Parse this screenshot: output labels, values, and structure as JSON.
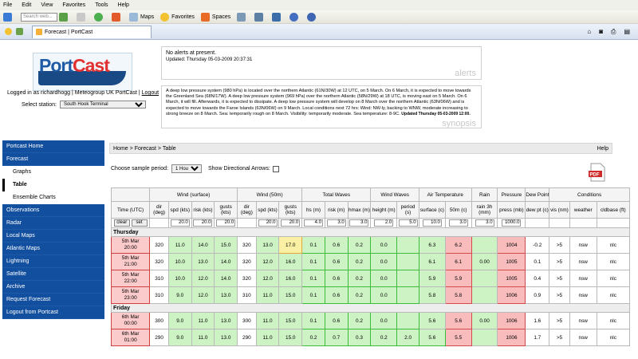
{
  "browser": {
    "menu": [
      "File",
      "Edit",
      "View",
      "Favorites",
      "Tools",
      "Help"
    ],
    "search_placeholder": "Search web...",
    "toolbar": {
      "maps": "Maps",
      "favorites": "Favorites",
      "spaces": "Spaces"
    },
    "tab_title": "Forecast | PortCast"
  },
  "header": {
    "logged_in": "Logged in as richardhogg",
    "org_link": "Meteogroup UK PortCast",
    "logout": "Logout",
    "station_label": "Select station:",
    "station_value": "South Hook Terminal"
  },
  "alerts": {
    "text": "No alerts at present.",
    "updated": "Updated: Thursday 05-03-2009 20:37:31",
    "label": "alerts"
  },
  "synopsis": {
    "text": "A deep low pressure system (980 hPa) is located over the northern Atlantic (61N/30W) at 12 UTC, on 5 March. On 6 March, it is expected to move towards the Greenland Sea (68N/17W). A deep low pressure system (969 hPa) over the northern Atlantic (58N/29W) at 18 UTC, is moving east on 5 March. On 6 March, it will fill. Afterwards, it is expected to dissipate. A deep low pressure system will develop on 8 March over the northern Atlantic (63N/06W) and is expected to move towards the Faroe Islands (63N/06W) on 9 March. Local conditions next 72 hrs: Wind: NW-ly, backing to WNW, moderate increasing to strong breeze on 8 March. Sea: temporarily rough on 8 March. Visibility: temporarily moderate. Sea temperature: 8-9C.",
    "updated": "Updated Thursday 05-03-2009 12:00.",
    "label": "synopsis"
  },
  "nav": {
    "items": [
      "Portcast Home",
      "Forecast"
    ],
    "sub": [
      "Graphs",
      "Table",
      "Ensemble Charts"
    ],
    "items2": [
      "Observations",
      "Radar",
      "Local Maps",
      "Atlantic Maps",
      "Lightning",
      "Satellite",
      "Archive",
      "Request Forecast",
      "Logout from Portcast"
    ]
  },
  "crumb": {
    "home": "Home",
    "sep": ">",
    "forecast": "Forecast",
    "table": "Table",
    "help": "Help"
  },
  "controls": {
    "period_label": "Choose sample period:",
    "period_value": "1 Hourly",
    "arrows_label": "Show Directional Arrows:"
  },
  "table": {
    "groups": [
      "Wind (surface)",
      "Wind (50m)",
      "Total Waves",
      "Wind Waves",
      "Air Temperature",
      "Rain",
      "Pressure",
      "Dew Point",
      "Conditions"
    ],
    "time_header": "Time (UTC)",
    "subheaders": [
      "dir (deg)",
      "spd (kts)",
      "risk (kts)",
      "gusts (kts)",
      "dir (deg)",
      "spd (kts)",
      "gusts (kts)",
      "hs (m)",
      "risk (m)",
      "hmax (m)",
      "height (m)",
      "period (s)",
      "surface (c)",
      "50m (c)",
      "rain 3h (mm)",
      "press (mb)",
      "dew pt (c)",
      "vis (nm)",
      "weather",
      "cldbase (ft)"
    ],
    "clear": "clear",
    "set": "set",
    "thresholds": [
      "",
      "20.0",
      "20.0",
      "20.0",
      "",
      "20.0",
      "20.0",
      "4.0",
      "3.0",
      "3.0",
      "2.0",
      "5.0",
      "10.0",
      "3.0",
      "3.0",
      "1000.0",
      "",
      "",
      "",
      ""
    ],
    "days": [
      {
        "label": "Thursday",
        "rows": [
          {
            "date": "5th Mar",
            "time": "20:00",
            "cells": [
              "320",
              "11.0",
              "14.0",
              "15.0",
              "320",
              "13.0",
              "17.0",
              "0.1",
              "0.6",
              "0.2",
              "0.0",
              "",
              "6.3",
              "6.2",
              "",
              "1004",
              "-0.2",
              ">5",
              "nsw",
              "nlc"
            ]
          },
          {
            "date": "5th Mar",
            "time": "21:00",
            "cells": [
              "320",
              "10.0",
              "13.0",
              "14.0",
              "320",
              "12.0",
              "16.0",
              "0.1",
              "0.6",
              "0.2",
              "0.0",
              "",
              "6.1",
              "6.1",
              "0.00",
              "1005",
              "0.1",
              ">5",
              "nsw",
              "nlc"
            ]
          },
          {
            "date": "5th Mar",
            "time": "22:00",
            "cells": [
              "310",
              "10.0",
              "12.0",
              "14.0",
              "320",
              "12.0",
              "16.0",
              "0.1",
              "0.6",
              "0.2",
              "0.0",
              "",
              "5.9",
              "5.9",
              "",
              "1005",
              "0.4",
              ">5",
              "nsw",
              "nlc"
            ]
          },
          {
            "date": "5th Mar",
            "time": "23:00",
            "cells": [
              "310",
              "9.0",
              "12.0",
              "13.0",
              "310",
              "11.0",
              "15.0",
              "0.1",
              "0.6",
              "0.2",
              "0.0",
              "",
              "5.8",
              "5.8",
              "",
              "1006",
              "0.9",
              ">5",
              "nsw",
              "nlc"
            ]
          }
        ]
      },
      {
        "label": "Friday",
        "rows": [
          {
            "date": "6th Mar",
            "time": "00:00",
            "cells": [
              "300",
              "9.0",
              "11.0",
              "13.0",
              "300",
              "11.0",
              "15.0",
              "0.1",
              "0.6",
              "0.2",
              "0.0",
              "",
              "5.6",
              "5.6",
              "0.00",
              "1006",
              "1.6",
              ">5",
              "nsw",
              "nlc"
            ]
          },
          {
            "date": "6th Mar",
            "time": "01:00",
            "cells": [
              "290",
              "9.0",
              "11.0",
              "13.0",
              "290",
              "11.0",
              "15.0",
              "0.2",
              "0.7",
              "0.3",
              "0.2",
              "2.0",
              "5.6",
              "5.5",
              "",
              "1006",
              "1.7",
              ">5",
              "nsw",
              "nlc"
            ]
          }
        ]
      }
    ]
  }
}
